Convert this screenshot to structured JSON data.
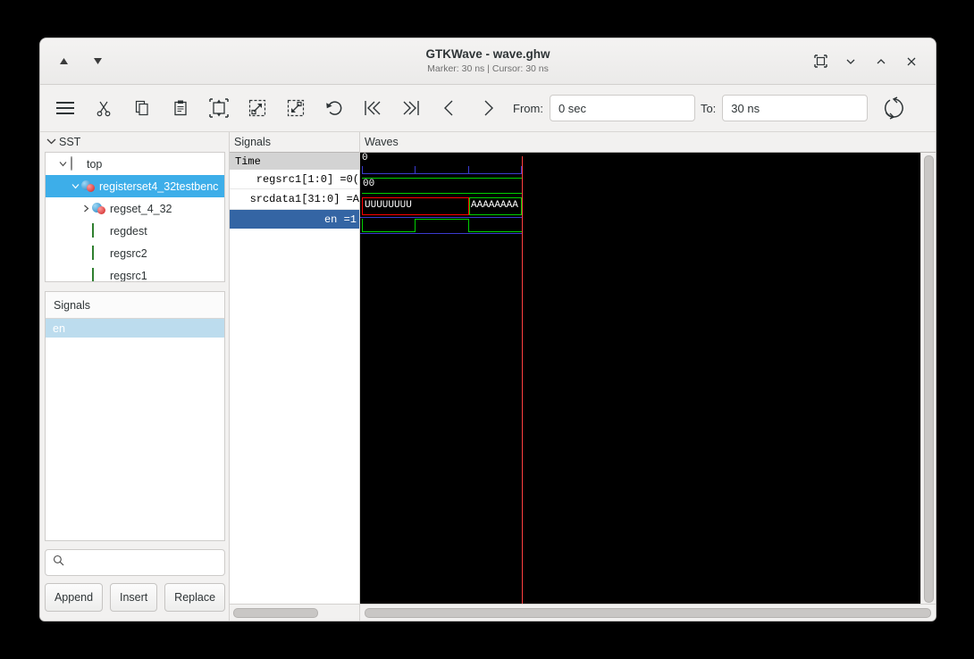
{
  "window": {
    "title": "GTKWave - wave.ghw",
    "subtitle": "Marker: 30 ns  |  Cursor: 30 ns",
    "nav_up_icon": "triangle-up-icon",
    "nav_down_icon": "triangle-down-icon",
    "controls": {
      "fullscreen_icon": "fullscreen-icon",
      "minimize_icon": "chevron-down-icon",
      "maximize_icon": "chevron-up-icon",
      "close_icon": "close-icon"
    }
  },
  "toolbar": {
    "icons": [
      "menu-icon",
      "cut-icon",
      "copy-icon",
      "paste-icon",
      "zoom-fit-icon",
      "zoom-in-icon",
      "zoom-out-icon",
      "undo-icon",
      "go-first-icon",
      "go-last-icon",
      "go-previous-icon",
      "go-next-icon"
    ],
    "from_label": "From:",
    "from_value": "0 sec",
    "to_label": "To:",
    "to_value": "30 ns",
    "reload_icon": "reload-icon"
  },
  "sst": {
    "header": "SST",
    "tree": [
      {
        "label": "top",
        "icon": "module-icon",
        "twisty": "expanded",
        "depth": 0,
        "selected": false
      },
      {
        "label": "registerset4_32testbenc",
        "icon": "scope-icon",
        "twisty": "expanded",
        "depth": 1,
        "selected": true
      },
      {
        "label": "regset_4_32",
        "icon": "scope-icon",
        "twisty": "collapsed",
        "depth": 2,
        "selected": false
      },
      {
        "label": "regdest",
        "icon": "signal-icon",
        "twisty": "none",
        "depth": 2,
        "selected": false
      },
      {
        "label": "regsrc2",
        "icon": "signal-icon",
        "twisty": "none",
        "depth": 2,
        "selected": false
      },
      {
        "label": "regsrc1",
        "icon": "signal-icon",
        "twisty": "none",
        "depth": 2,
        "selected": false
      }
    ]
  },
  "signals_panel": {
    "header": "Signals",
    "items": [
      {
        "label": "en",
        "selected": true
      }
    ],
    "search_placeholder": "",
    "search_value": "",
    "search_icon": "search-icon",
    "buttons": [
      "Append",
      "Insert",
      "Replace"
    ]
  },
  "names_panel": {
    "title": "Signals",
    "rows": [
      {
        "label": "Time",
        "kind": "header"
      },
      {
        "label": "regsrc1[1:0] =0(",
        "kind": "signal"
      },
      {
        "label": "srcdata1[31:0] =A",
        "kind": "signal"
      },
      {
        "label": "en =1",
        "kind": "signal",
        "selected": true
      }
    ]
  },
  "waves_panel": {
    "title": "Waves",
    "time_origin_label": "0",
    "cursor_color": "#ff4040",
    "signal_color": "#00d000",
    "undefined_color": "#ff0000",
    "grid_color": "#3b3bd0"
  },
  "chart_data": {
    "type": "waveform",
    "title": "Waves",
    "time_unit": "ns",
    "xlim": [
      0,
      30
    ],
    "marker_ns": 30,
    "cursor_ns": 30,
    "ruler_ticks_ns": [
      0,
      10,
      20,
      30
    ],
    "signals": [
      {
        "name": "regsrc1[1:0]",
        "type": "bus",
        "color": "#00d000",
        "transitions": [
          {
            "t": 0,
            "value": "00"
          }
        ]
      },
      {
        "name": "srcdata1[31:0]",
        "type": "bus",
        "color": "#00d000",
        "transitions": [
          {
            "t": 0,
            "value": "UUUUUUUU",
            "undefined": true
          },
          {
            "t": 20,
            "value": "AAAAAAAA",
            "undefined": false
          }
        ]
      },
      {
        "name": "en",
        "type": "bit",
        "color": "#00d000",
        "transitions": [
          {
            "t": 0,
            "value": 0
          },
          {
            "t": 10,
            "value": 1
          },
          {
            "t": 20,
            "value": 0
          }
        ]
      }
    ]
  }
}
